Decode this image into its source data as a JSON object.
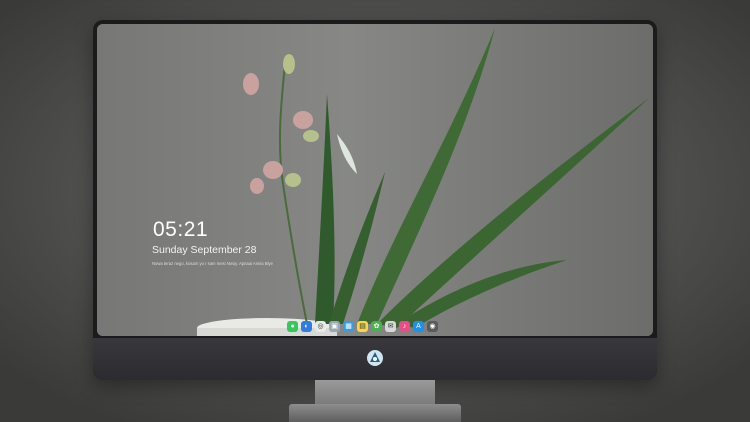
{
  "lock_screen": {
    "time": "05:21",
    "date": "Sunday September  28",
    "note": "Nowa teraz nego, kosam yo r sam mesi Nwuy. Apnaai  Annia Blye"
  },
  "dock": {
    "apps": [
      {
        "name": "messages-icon",
        "glyph": "●",
        "color": "#34c759"
      },
      {
        "name": "finder-icon",
        "glyph": "◐",
        "color": "#2f7de1"
      },
      {
        "name": "safari-icon",
        "glyph": "◎",
        "color": "#e9e9ea"
      },
      {
        "name": "preview-icon",
        "glyph": "▣",
        "color": "#9aa8b5"
      },
      {
        "name": "clapper-icon",
        "glyph": "▦",
        "color": "#3a9be0"
      },
      {
        "name": "notes-icon",
        "glyph": "▤",
        "color": "#f5d54a"
      },
      {
        "name": "photos-icon",
        "glyph": "✿",
        "color": "#4caf50"
      },
      {
        "name": "mail-icon",
        "glyph": "✉",
        "color": "#d7d7d7"
      },
      {
        "name": "music-icon",
        "glyph": "♪",
        "color": "#ea4c89"
      },
      {
        "name": "appstore-icon",
        "glyph": "A",
        "color": "#1f8ef1"
      },
      {
        "name": "camera-icon",
        "glyph": "◉",
        "color": "#5a5a5e"
      }
    ]
  }
}
